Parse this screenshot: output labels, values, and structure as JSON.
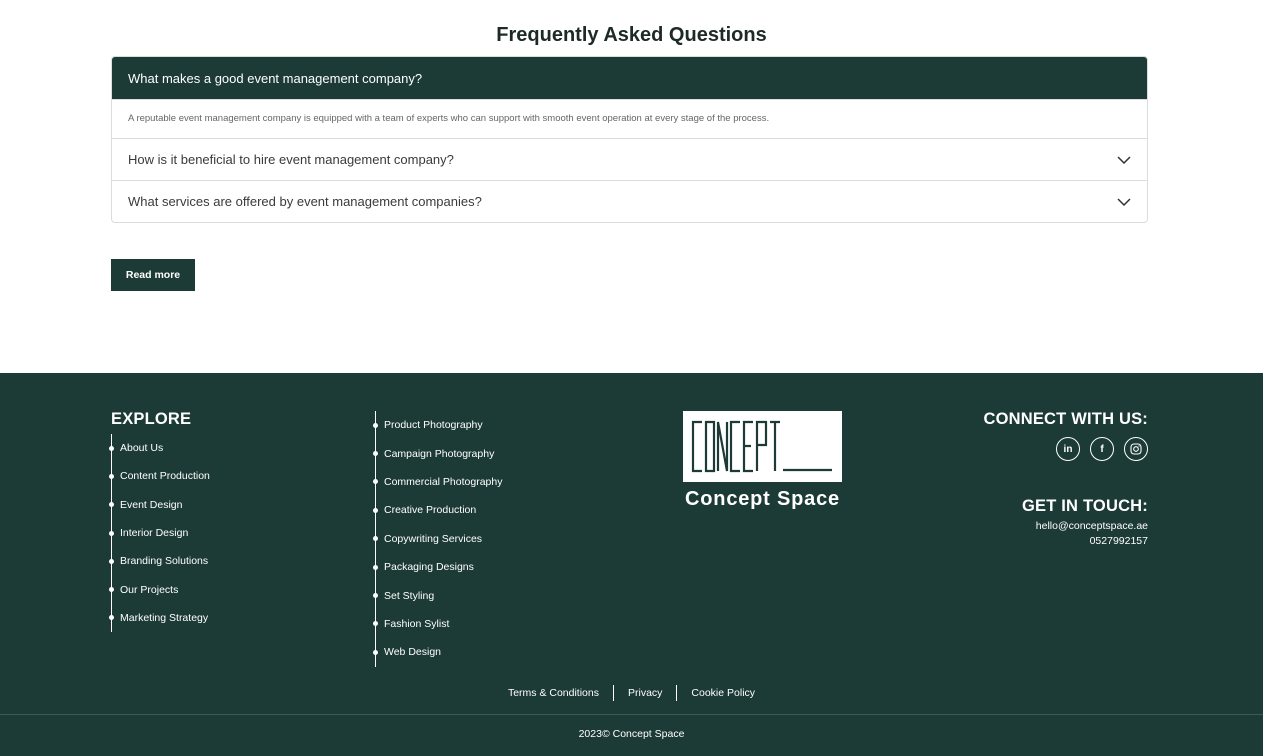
{
  "faq": {
    "title": "Frequently Asked Questions",
    "items": [
      {
        "question": "What makes a good event management company?",
        "answer": "A reputable event management company is equipped with a team of experts who can support with smooth event operation at every stage of the process.",
        "expanded": true
      },
      {
        "question": "How is it beneficial to hire event management company?",
        "expanded": false
      },
      {
        "question": "What services are offered by event management companies?",
        "expanded": false
      }
    ],
    "read_more_label": "Read more"
  },
  "footer": {
    "explore_title": "EXPLORE",
    "explore_links": [
      "About Us",
      "Content Production",
      "Event Design",
      "Interior Design",
      "Branding Solutions",
      "Our Projects",
      "Marketing Strategy"
    ],
    "service_links": [
      "Product Photography",
      "Campaign Photography",
      "Commercial Photography",
      "Creative Production",
      "Copywriting Services",
      "Packaging Designs",
      "Set Styling",
      "Fashion Sylist",
      "Web Design"
    ],
    "logo": {
      "wordmark": "CONCEPT",
      "name": "Concept Space"
    },
    "connect_title": "CONNECT WITH US:",
    "socials": [
      {
        "icon": "linkedin-icon",
        "glyph": "in"
      },
      {
        "icon": "facebook-icon",
        "glyph": "f"
      },
      {
        "icon": "instagram-icon",
        "glyph": ""
      }
    ],
    "touch_title": "GET IN TOUCH:",
    "email": "hello@conceptspace.ae",
    "phone": "0527992157",
    "legal": [
      "Terms & Conditions",
      "Privacy",
      "Cookie Policy"
    ],
    "copyright": "2023© Concept Space"
  },
  "colors": {
    "brand": "#1c3a36",
    "text_dark": "#1d2a27",
    "border": "#dcdcdc"
  }
}
